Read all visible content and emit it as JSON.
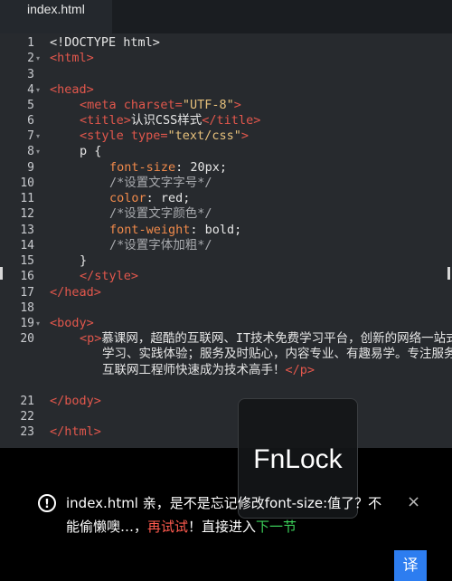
{
  "tab": {
    "filename": "index.html"
  },
  "lines": [
    {
      "num": "1",
      "fold": ""
    },
    {
      "num": "2",
      "fold": "▾"
    },
    {
      "num": "3",
      "fold": ""
    },
    {
      "num": "4",
      "fold": "▾"
    },
    {
      "num": "5",
      "fold": ""
    },
    {
      "num": "6",
      "fold": ""
    },
    {
      "num": "7",
      "fold": "▾"
    },
    {
      "num": "8",
      "fold": "▾"
    },
    {
      "num": "9",
      "fold": ""
    },
    {
      "num": "10",
      "fold": ""
    },
    {
      "num": "11",
      "fold": ""
    },
    {
      "num": "12",
      "fold": ""
    },
    {
      "num": "13",
      "fold": ""
    },
    {
      "num": "14",
      "fold": ""
    },
    {
      "num": "15",
      "fold": ""
    },
    {
      "num": "16",
      "fold": ""
    },
    {
      "num": "17",
      "fold": ""
    },
    {
      "num": "18",
      "fold": ""
    },
    {
      "num": "19",
      "fold": "▾"
    },
    {
      "num": "20",
      "fold": ""
    },
    {
      "num": "21",
      "fold": ""
    },
    {
      "num": "22",
      "fold": ""
    },
    {
      "num": "23",
      "fold": ""
    }
  ],
  "code": {
    "l1": "<!DOCTYPE html>",
    "l2": "<html>",
    "l4": "<head>",
    "l5_open": "<meta ",
    "l5_attr": "charset=",
    "l5_val": "\"UTF-8\"",
    "l5_close": ">",
    "l6_open": "<title>",
    "l6_text": "认识CSS样式",
    "l6_close": "</title>",
    "l7_open": "<style ",
    "l7_attr": "type=",
    "l7_val": "\"text/css\"",
    "l7_close": ">",
    "l8": "p {",
    "l9_prop": "font-size",
    "l9_val": ": 20px;",
    "l10": "/*设置文字字号*/",
    "l11_prop": "color",
    "l11_val": ": red;",
    "l12": "/*设置文字颜色*/",
    "l13_prop": "font-weight",
    "l13_val": ": bold;",
    "l14": "/*设置字体加粗*/",
    "l15": "}",
    "l16": "</style>",
    "l17": "</head>",
    "l19": "<body>",
    "l20_open": "<p>",
    "l20_text": "慕课网，超酷的互联网、IT技术免费学习平台，创新的网络一站式学习、实践体验；服务及时贴心，内容专业、有趣易学。专注服务互联网工程师快速成为技术高手！",
    "l20_close": "</p>",
    "l21": "</body>",
    "l23": "</html>"
  },
  "overlay": {
    "fnlock": "FnLock"
  },
  "notice": {
    "icon": "!",
    "prefix": "index.html 亲，是不是忘记修改font-size:值了？不能偷懒噢…，",
    "retry": "再试试",
    "middle": "！直接进入",
    "next": "下一节"
  },
  "close": "×",
  "translate": "译",
  "colors": {
    "tag": "#e2574c",
    "string": "#e6c07b",
    "retry": "#ff5a4e",
    "next": "#3ccf5a",
    "translate_bg": "#2d7df0"
  }
}
